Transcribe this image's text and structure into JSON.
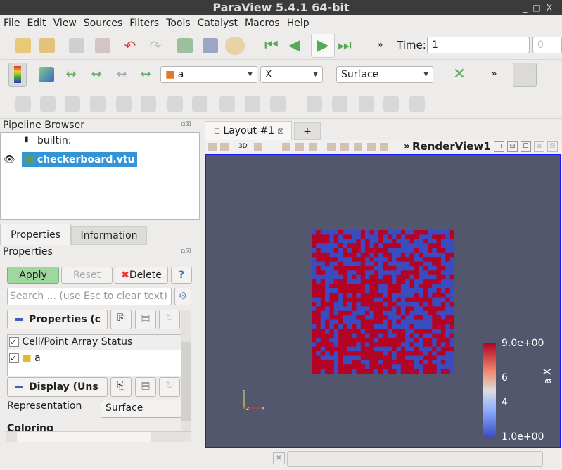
{
  "window": {
    "title": "ParaView 5.4.1 64-bit",
    "controls": [
      "_",
      "□",
      "X"
    ]
  },
  "menu": [
    "File",
    "Edit",
    "View",
    "Sources",
    "Filters",
    "Tools",
    "Catalyst",
    "Macros",
    "Help"
  ],
  "toolbar1": {
    "overflow": "»",
    "time_label": "Time:",
    "time_value": "1",
    "time_index": "0"
  },
  "toolbar2": {
    "array": "a",
    "component": "X",
    "representation": "Surface",
    "overflow": "»"
  },
  "pipeline": {
    "title": "Pipeline Browser",
    "items": [
      "builtin:",
      "checkerboard.vtu"
    ]
  },
  "tabs": {
    "properties": "Properties",
    "information": "Information"
  },
  "properties": {
    "title": "Properties",
    "apply": "Apply",
    "reset": "Reset",
    "delete": "Delete",
    "help": "?",
    "search_placeholder": "Search ... (use Esc to clear text)",
    "section1": "Properties (c",
    "array_status_header": "Cell/Point Array Status",
    "arrays": [
      "a"
    ],
    "section2": "Display (Uns",
    "representation_label": "Representation",
    "representation_value": "Surface",
    "coloring_label": "Coloring"
  },
  "layout": {
    "tab": "Layout #1",
    "add_tab": "+",
    "toolbar_3d": "3D",
    "overflow": "»",
    "view_name": "RenderView1"
  },
  "colorbar": {
    "title": "a X",
    "max_label": "9.0e+00",
    "min_label": "1.0e+00",
    "ticks": [
      "6",
      "4"
    ],
    "range": [
      1,
      9
    ],
    "tick_values": [
      6,
      4
    ]
  },
  "colors": {
    "background": "#52576e",
    "red": "#b40426",
    "blue": "#3b4cc0",
    "accent": "#1a1aff"
  }
}
